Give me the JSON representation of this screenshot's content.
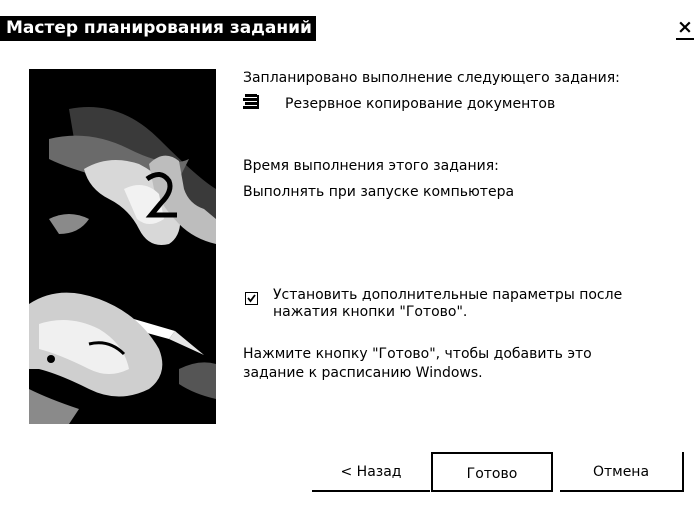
{
  "window": {
    "title": "Мастер планирования заданий",
    "close_glyph": "×"
  },
  "summary": {
    "scheduled_label": "Запланировано выполнение следующего задания:",
    "task_icon": "task-list-icon",
    "task_name": "Резервное копирование документов",
    "time_label": "Время выполнения этого задания:",
    "time_value": "Выполнять при запуске компьютера"
  },
  "advanced_option": {
    "checked": true,
    "label_line1": "Установить дополнительные параметры после",
    "label_line2": "нажатия кнопки \"Готово\"."
  },
  "instruction": {
    "line1": "Нажмите кнопку \"Готово\", чтобы добавить это",
    "line2": "задание к расписанию Windows."
  },
  "buttons": {
    "back": "< Назад",
    "finish": "Готово",
    "cancel": "Отмена"
  },
  "colors": {
    "title_bg": "#000000",
    "title_fg": "#ffffff",
    "background": "#ffffff"
  }
}
